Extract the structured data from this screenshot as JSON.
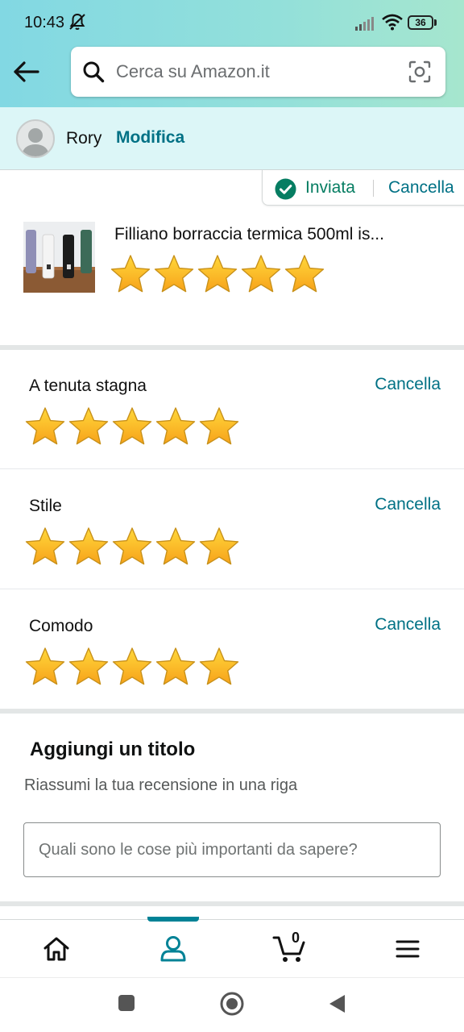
{
  "status_bar": {
    "time": "10:43",
    "battery": "36"
  },
  "search": {
    "placeholder": "Cerca su Amazon.it"
  },
  "profile": {
    "name": "Rory",
    "edit_label": "Modifica"
  },
  "review_status": {
    "state_label": "Inviata",
    "cancel_label": "Cancella"
  },
  "product": {
    "title": "Filliano borraccia termica 500ml is...",
    "rating": 5,
    "max_rating": 5
  },
  "attributes": [
    {
      "label": "A tenuta stagna",
      "rating": 5,
      "cancel_label": "Cancella"
    },
    {
      "label": "Stile",
      "rating": 5,
      "cancel_label": "Cancella"
    },
    {
      "label": "Comodo",
      "rating": 5,
      "cancel_label": "Cancella"
    }
  ],
  "title_section": {
    "heading": "Aggiungi un titolo",
    "subheading": "Riassumi la tua recensione in una riga",
    "input_placeholder": "Quali sono le cose più importanti da sapere?",
    "input_value": ""
  },
  "bottom_nav": {
    "active": "account",
    "cart_count": "0",
    "icons": [
      "home-icon",
      "account-icon",
      "cart-icon",
      "menu-icon"
    ]
  },
  "colors": {
    "link": "#007185",
    "star_fill": "#ffa41c",
    "success": "#067d62",
    "header_start": "#82d8e3",
    "header_end": "#a6e6ce"
  }
}
